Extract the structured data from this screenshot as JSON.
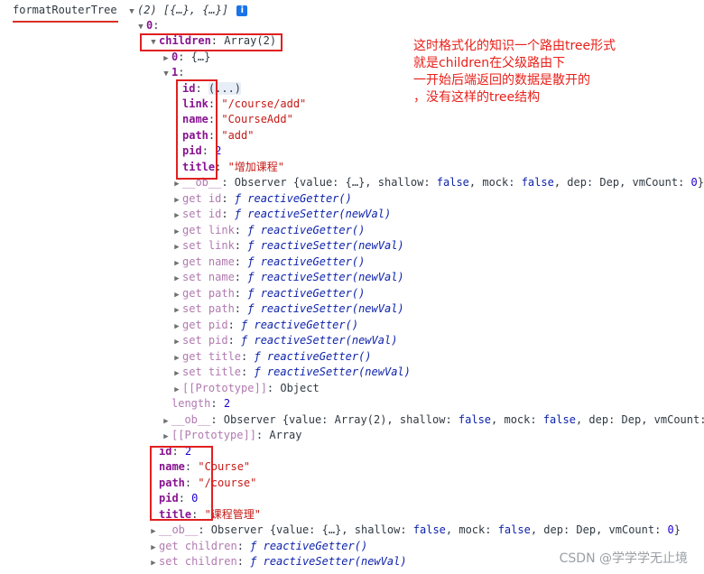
{
  "log": {
    "name": "formatRouterTree",
    "summary": "(2) [{…}, {…}]",
    "info_icon": "i"
  },
  "annotation": {
    "lines": [
      "这时格式化的知识一个路由tree形式",
      "就是children在父级路由下",
      "一开始后端返回的数据是散开的",
      "，没有这样的tree结构"
    ]
  },
  "watermark": "CSDN @学学学无止境",
  "rows": [
    {
      "tri": "open",
      "parts": [
        {
          "t": "0",
          "c": "key-bold"
        },
        {
          "t": ":",
          "c": "plain"
        }
      ]
    },
    {
      "tri": "open",
      "parts": [
        {
          "t": "children",
          "c": "key-bold"
        },
        {
          "t": ": Array(2)",
          "c": "plain"
        }
      ]
    },
    {
      "tri": "closed",
      "parts": [
        {
          "t": "0",
          "c": "key-bold"
        },
        {
          "t": ": {…}",
          "c": "plain"
        }
      ]
    },
    {
      "tri": "open",
      "parts": [
        {
          "t": "1",
          "c": "key-bold"
        },
        {
          "t": ":",
          "c": "plain"
        }
      ]
    },
    {
      "tri": "",
      "parts": [
        {
          "t": "id",
          "c": "key-bold"
        },
        {
          "t": ": ",
          "c": "plain"
        },
        {
          "t": "(...)",
          "c": "plain hl"
        }
      ]
    },
    {
      "tri": "",
      "parts": [
        {
          "t": "link",
          "c": "key-bold"
        },
        {
          "t": ": ",
          "c": "plain"
        },
        {
          "t": "\"/course/add\"",
          "c": "str"
        }
      ]
    },
    {
      "tri": "",
      "parts": [
        {
          "t": "name",
          "c": "key-bold"
        },
        {
          "t": ": ",
          "c": "plain"
        },
        {
          "t": "\"CourseAdd\"",
          "c": "str"
        }
      ]
    },
    {
      "tri": "",
      "parts": [
        {
          "t": "path",
          "c": "key-bold"
        },
        {
          "t": ": ",
          "c": "plain"
        },
        {
          "t": "\"add\"",
          "c": "str"
        }
      ]
    },
    {
      "tri": "",
      "parts": [
        {
          "t": "pid",
          "c": "key-bold"
        },
        {
          "t": ": ",
          "c": "plain"
        },
        {
          "t": "2",
          "c": "num"
        }
      ]
    },
    {
      "tri": "",
      "parts": [
        {
          "t": "title",
          "c": "key-bold"
        },
        {
          "t": ": ",
          "c": "plain"
        },
        {
          "t": "\"增加课程\"",
          "c": "str"
        }
      ]
    },
    {
      "tri": "closed",
      "parts": [
        {
          "t": "__ob__",
          "c": "dim"
        },
        {
          "t": ": Observer {value: {…}, shallow: ",
          "c": "plain"
        },
        {
          "t": "false",
          "c": "bool"
        },
        {
          "t": ", mock: ",
          "c": "plain"
        },
        {
          "t": "false",
          "c": "bool"
        },
        {
          "t": ", dep: Dep, vmCount: ",
          "c": "plain"
        },
        {
          "t": "0",
          "c": "num"
        },
        {
          "t": "}",
          "c": "plain"
        }
      ]
    },
    {
      "tri": "closed",
      "parts": [
        {
          "t": "get id",
          "c": "dim"
        },
        {
          "t": ": ",
          "c": "plain"
        },
        {
          "t": "ƒ reactiveGetter()",
          "c": "fn"
        }
      ]
    },
    {
      "tri": "closed",
      "parts": [
        {
          "t": "set id",
          "c": "dim"
        },
        {
          "t": ": ",
          "c": "plain"
        },
        {
          "t": "ƒ reactiveSetter(newVal)",
          "c": "fn"
        }
      ]
    },
    {
      "tri": "closed",
      "parts": [
        {
          "t": "get link",
          "c": "dim"
        },
        {
          "t": ": ",
          "c": "plain"
        },
        {
          "t": "ƒ reactiveGetter()",
          "c": "fn"
        }
      ]
    },
    {
      "tri": "closed",
      "parts": [
        {
          "t": "set link",
          "c": "dim"
        },
        {
          "t": ": ",
          "c": "plain"
        },
        {
          "t": "ƒ reactiveSetter(newVal)",
          "c": "fn"
        }
      ]
    },
    {
      "tri": "closed",
      "parts": [
        {
          "t": "get name",
          "c": "dim"
        },
        {
          "t": ": ",
          "c": "plain"
        },
        {
          "t": "ƒ reactiveGetter()",
          "c": "fn"
        }
      ]
    },
    {
      "tri": "closed",
      "parts": [
        {
          "t": "set name",
          "c": "dim"
        },
        {
          "t": ": ",
          "c": "plain"
        },
        {
          "t": "ƒ reactiveSetter(newVal)",
          "c": "fn"
        }
      ]
    },
    {
      "tri": "closed",
      "parts": [
        {
          "t": "get path",
          "c": "dim"
        },
        {
          "t": ": ",
          "c": "plain"
        },
        {
          "t": "ƒ reactiveGetter()",
          "c": "fn"
        }
      ]
    },
    {
      "tri": "closed",
      "parts": [
        {
          "t": "set path",
          "c": "dim"
        },
        {
          "t": ": ",
          "c": "plain"
        },
        {
          "t": "ƒ reactiveSetter(newVal)",
          "c": "fn"
        }
      ]
    },
    {
      "tri": "closed",
      "parts": [
        {
          "t": "get pid",
          "c": "dim"
        },
        {
          "t": ": ",
          "c": "plain"
        },
        {
          "t": "ƒ reactiveGetter()",
          "c": "fn"
        }
      ]
    },
    {
      "tri": "closed",
      "parts": [
        {
          "t": "set pid",
          "c": "dim"
        },
        {
          "t": ": ",
          "c": "plain"
        },
        {
          "t": "ƒ reactiveSetter(newVal)",
          "c": "fn"
        }
      ]
    },
    {
      "tri": "closed",
      "parts": [
        {
          "t": "get title",
          "c": "dim"
        },
        {
          "t": ": ",
          "c": "plain"
        },
        {
          "t": "ƒ reactiveGetter()",
          "c": "fn"
        }
      ]
    },
    {
      "tri": "closed",
      "parts": [
        {
          "t": "set title",
          "c": "dim"
        },
        {
          "t": ": ",
          "c": "plain"
        },
        {
          "t": "ƒ reactiveSetter(newVal)",
          "c": "fn"
        }
      ]
    },
    {
      "tri": "closed",
      "parts": [
        {
          "t": "[[Prototype]]",
          "c": "dim"
        },
        {
          "t": ": Object",
          "c": "plain"
        }
      ]
    },
    {
      "tri": "",
      "parts": [
        {
          "t": "length",
          "c": "dim"
        },
        {
          "t": ": ",
          "c": "plain"
        },
        {
          "t": "2",
          "c": "num"
        }
      ]
    },
    {
      "tri": "closed",
      "parts": [
        {
          "t": "__ob__",
          "c": "dim"
        },
        {
          "t": ": Observer {value: Array(2), shallow: ",
          "c": "plain"
        },
        {
          "t": "false",
          "c": "bool"
        },
        {
          "t": ", mock: ",
          "c": "plain"
        },
        {
          "t": "false",
          "c": "bool"
        },
        {
          "t": ", dep: Dep, vmCount:",
          "c": "plain"
        }
      ]
    },
    {
      "tri": "closed",
      "parts": [
        {
          "t": "[[Prototype]]",
          "c": "dim"
        },
        {
          "t": ": Array",
          "c": "plain"
        }
      ]
    },
    {
      "tri": "",
      "parts": [
        {
          "t": "id",
          "c": "key-bold"
        },
        {
          "t": ": ",
          "c": "plain"
        },
        {
          "t": "2",
          "c": "num"
        }
      ]
    },
    {
      "tri": "",
      "parts": [
        {
          "t": "name",
          "c": "key-bold"
        },
        {
          "t": ": ",
          "c": "plain"
        },
        {
          "t": "\"Course\"",
          "c": "str"
        }
      ]
    },
    {
      "tri": "",
      "parts": [
        {
          "t": "path",
          "c": "key-bold"
        },
        {
          "t": ": ",
          "c": "plain"
        },
        {
          "t": "\"/course\"",
          "c": "str"
        }
      ]
    },
    {
      "tri": "",
      "parts": [
        {
          "t": "pid",
          "c": "key-bold"
        },
        {
          "t": ": ",
          "c": "plain"
        },
        {
          "t": "0",
          "c": "num"
        }
      ]
    },
    {
      "tri": "",
      "parts": [
        {
          "t": "title",
          "c": "key-bold"
        },
        {
          "t": ": ",
          "c": "plain"
        },
        {
          "t": "\"课程管理\"",
          "c": "str"
        }
      ]
    },
    {
      "tri": "closed",
      "parts": [
        {
          "t": "__ob__",
          "c": "dim"
        },
        {
          "t": ": Observer {value: {…}, shallow: ",
          "c": "plain"
        },
        {
          "t": "false",
          "c": "bool"
        },
        {
          "t": ", mock: ",
          "c": "plain"
        },
        {
          "t": "false",
          "c": "bool"
        },
        {
          "t": ", dep: Dep, vmCount: ",
          "c": "plain"
        },
        {
          "t": "0",
          "c": "num"
        },
        {
          "t": "}",
          "c": "plain"
        }
      ]
    },
    {
      "tri": "closed",
      "parts": [
        {
          "t": "get children",
          "c": "dim"
        },
        {
          "t": ": ",
          "c": "plain"
        },
        {
          "t": "ƒ reactiveGetter()",
          "c": "fn"
        }
      ]
    },
    {
      "tri": "closed",
      "parts": [
        {
          "t": "set children",
          "c": "dim"
        },
        {
          "t": ": ",
          "c": "plain"
        },
        {
          "t": "ƒ reactiveSetter(newVal)",
          "c": "fn"
        }
      ]
    }
  ]
}
